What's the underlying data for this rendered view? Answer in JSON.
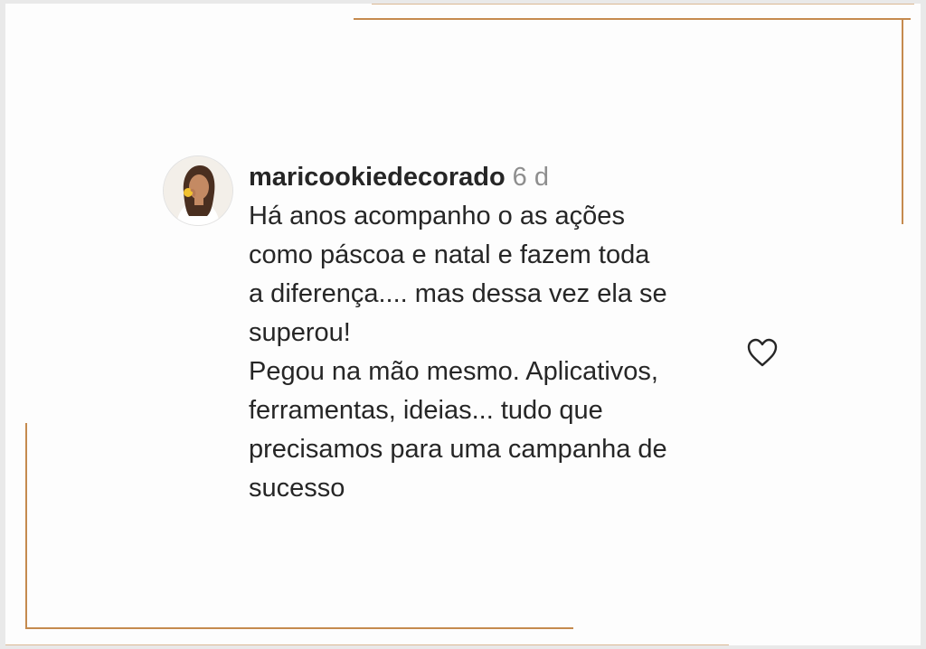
{
  "comment": {
    "username": "maricookiedecorado",
    "time": "6 d",
    "text": "Há anos acompanho o as ações\ncomo páscoa e natal e fazem toda\na diferença.... mas dessa vez ela se\nsuperou!\nPegou na mão mesmo. Aplicativos,\nferramentas, ideias... tudo que\nprecisamos para uma campanha de\nsucesso",
    "avatar_icon": "profile-photo",
    "like_icon": "heart-outline-icon"
  },
  "colors": {
    "frame": "#c58a4e",
    "username": "#262626",
    "timestamp": "#8e8e8e",
    "text": "#262626"
  }
}
